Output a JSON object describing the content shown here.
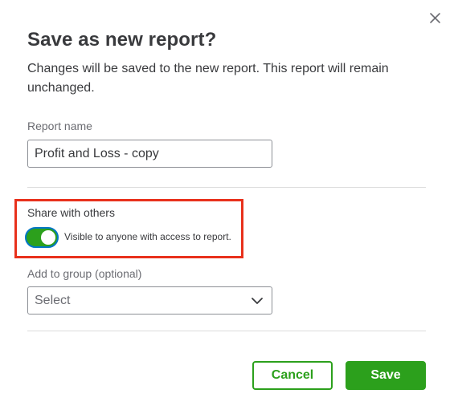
{
  "dialog": {
    "title": "Save as new report?",
    "description": "Changes will be saved to the new report. This report will remain unchanged.",
    "close_icon": "close-icon"
  },
  "report_name": {
    "label": "Report name",
    "value": "Profit and Loss - copy"
  },
  "share": {
    "label": "Share with others",
    "toggle_on": true,
    "toggle_text": "Visible to anyone with access to report."
  },
  "group": {
    "label": "Add to group (optional)",
    "selected": "Select",
    "icon": "chevron-down-icon"
  },
  "actions": {
    "cancel_label": "Cancel",
    "save_label": "Save"
  },
  "colors": {
    "brand_green": "#2ca01c",
    "focus_blue": "#0077c5",
    "highlight_red": "#e8311c",
    "text_dark": "#393a3d",
    "text_muted": "#6b6c72"
  }
}
